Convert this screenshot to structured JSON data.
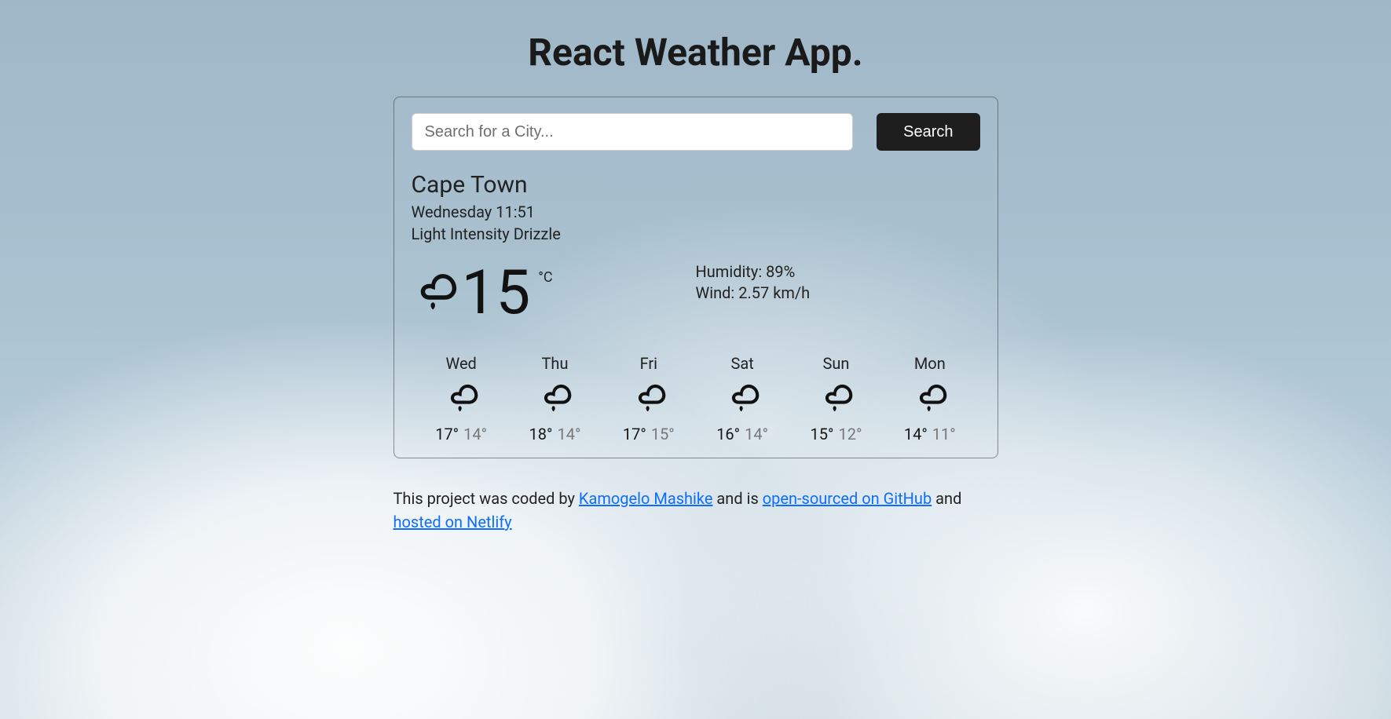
{
  "header": {
    "title": "React Weather App."
  },
  "search": {
    "placeholder": "Search for a City...",
    "button_label": "Search"
  },
  "current": {
    "city": "Cape Town",
    "datetime": "Wednesday 11:51",
    "condition": "Light Intensity Drizzle",
    "icon": "drizzle-icon",
    "temperature": "15",
    "unit": "°C",
    "humidity_label": "Humidity: 89%",
    "wind_label": "Wind: 2.57 km/h"
  },
  "forecast": [
    {
      "day": "Wed",
      "icon": "drizzle-icon",
      "high": "17°",
      "low": "14°"
    },
    {
      "day": "Thu",
      "icon": "drizzle-icon",
      "high": "18°",
      "low": "14°"
    },
    {
      "day": "Fri",
      "icon": "drizzle-icon",
      "high": "17°",
      "low": "15°"
    },
    {
      "day": "Sat",
      "icon": "drizzle-icon",
      "high": "16°",
      "low": "14°"
    },
    {
      "day": "Sun",
      "icon": "drizzle-icon",
      "high": "15°",
      "low": "12°"
    },
    {
      "day": "Mon",
      "icon": "drizzle-icon",
      "high": "14°",
      "low": "11°"
    }
  ],
  "footer": {
    "text_before": "This project was coded by ",
    "link1": "Kamogelo Mashike",
    "text_mid1": " and is ",
    "link2": "open-sourced on GitHub",
    "text_mid2": " and",
    "link3": " hosted on Netlify"
  }
}
